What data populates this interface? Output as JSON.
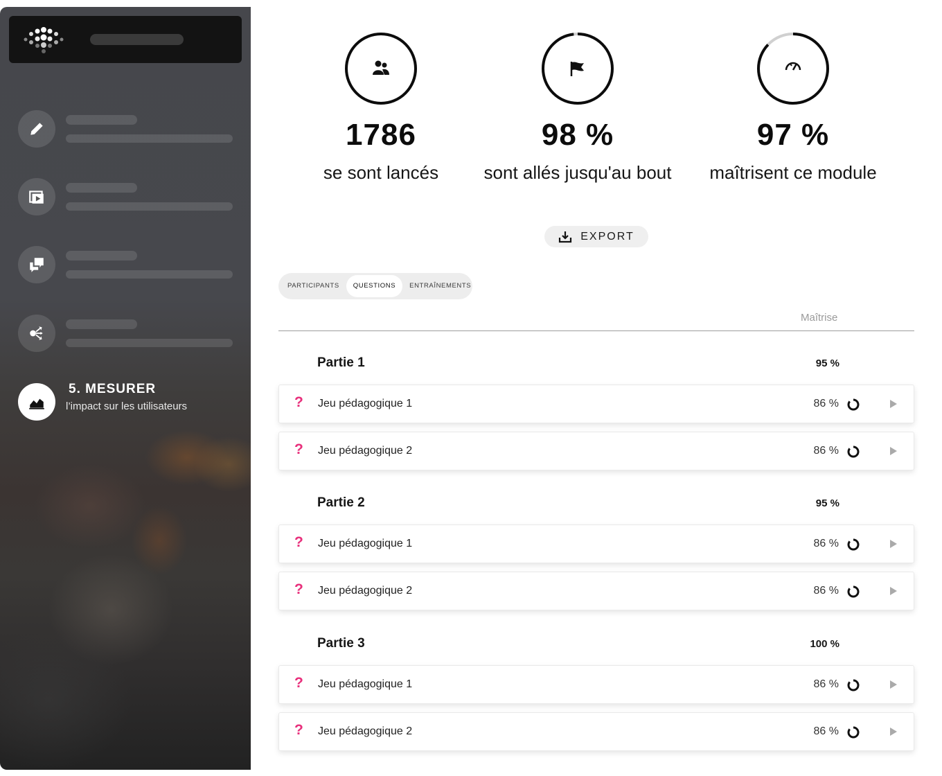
{
  "sidebar": {
    "active_item": {
      "title": "5. MESURER",
      "subtitle": "l’impact sur les utilisateurs",
      "icon": "chart-area-icon"
    },
    "icons": [
      "pencil-icon",
      "video-play-icon",
      "chat-bubbles-icon",
      "share-network-icon"
    ]
  },
  "stats": [
    {
      "value": "1786",
      "label": "se sont lancés",
      "icon": "users-icon",
      "ring_fraction": 1.0
    },
    {
      "value": "98 %",
      "label": "sont allés jusqu'au bout",
      "icon": "flag-icon",
      "ring_fraction": 0.98
    },
    {
      "value": "97 %",
      "label": "maîtrisent ce module",
      "icon": "gauge-icon",
      "ring_fraction": 0.87
    }
  ],
  "export": {
    "label": "EXPORT",
    "icon": "download-icon"
  },
  "tabs": [
    {
      "label": "PARTICIPANTS",
      "active": false
    },
    {
      "label": "QUESTIONS",
      "active": true
    },
    {
      "label": "ENTRAÎNEMENTS",
      "active": false
    }
  ],
  "table": {
    "column_header": "Maîtrise",
    "sections": [
      {
        "title": "Partie 1",
        "score": "95 %",
        "rows": [
          {
            "label": "Jeu pédagogique 1",
            "score": "86 %",
            "fraction": 0.86
          },
          {
            "label": "Jeu pédagogique 2",
            "score": "86 %",
            "fraction": 0.86
          }
        ]
      },
      {
        "title": "Partie 2",
        "score": "95 %",
        "rows": [
          {
            "label": "Jeu pédagogique 1",
            "score": "86 %",
            "fraction": 0.86
          },
          {
            "label": "Jeu pédagogique 2",
            "score": "86 %",
            "fraction": 0.86
          }
        ]
      },
      {
        "title": "Partie 3",
        "score": "100 %",
        "rows": [
          {
            "label": "Jeu pédagogique 1",
            "score": "86 %",
            "fraction": 0.86
          },
          {
            "label": "Jeu pédagogique 2",
            "score": "86 %",
            "fraction": 0.86
          }
        ]
      }
    ]
  },
  "colors": {
    "accent": "#e8307c",
    "ring": "#0c0c0c",
    "ring_track": "#d0d0d0",
    "sidebar_header": "#131313"
  }
}
